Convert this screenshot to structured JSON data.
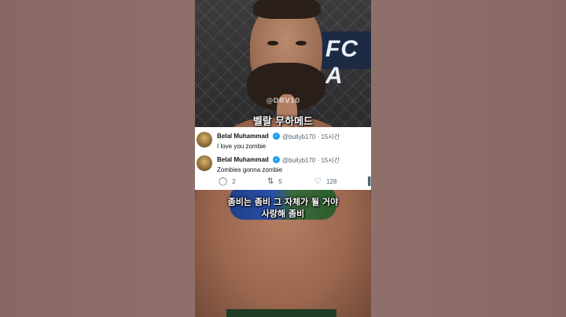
{
  "overlay": {
    "watermark": "@DRV10",
    "title": "벨랄 무하메드"
  },
  "tweets": [
    {
      "name": "Belal Muhammad",
      "handle": "@bullyb170 · 15시간",
      "text": "I love you zombie"
    },
    {
      "name": "Belal Muhammad",
      "handle": "@bullyb170 · 15시간",
      "text": "Zombies gonna zombie"
    }
  ],
  "actions": {
    "reply_count": "2",
    "retweet_count": "5",
    "like_count": "128"
  },
  "subtitles": {
    "line1": "좀비는 좀비 그 자체가 될 거야",
    "line2": "사랑해 좀비"
  },
  "banner_text": "FC A",
  "icons": {
    "verified": "verified-badge-icon",
    "reply": "reply-icon",
    "retweet": "retweet-icon",
    "like": "heart-icon",
    "views": "views-icon"
  },
  "colors": {
    "verified": "#1d9bf0",
    "secondary_text": "#536471",
    "card_bg": "#ffffff",
    "side_bg": "#8a6c66"
  }
}
